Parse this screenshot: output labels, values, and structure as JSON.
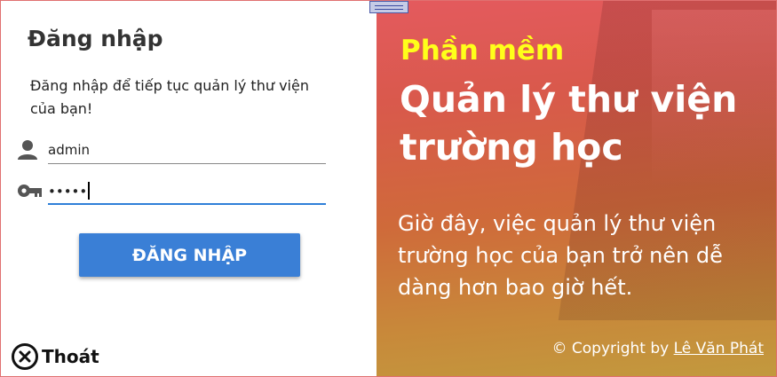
{
  "login": {
    "title": "Đăng nhập",
    "subtitle": "Đăng nhập để tiếp tục quản lý thư viện của bạn!",
    "username_value": "admin",
    "password_masked": "•••••",
    "login_button": "ĐĂNG NHẬP",
    "exit_label": "Thoát"
  },
  "icons": {
    "user": "person-icon",
    "key": "key-icon",
    "exit": "close-circle-icon"
  },
  "promo": {
    "kicker": "Phần mềm",
    "headline": "Quản lý thư viện trường học",
    "description": "Giờ đây, việc quản lý thư viện trường học của bạn trở nên dễ dàng hơn bao giờ hết.",
    "copyright_prefix": "© Copyright by ",
    "author": "Lê Văn Phát"
  },
  "colors": {
    "accent": "#3a7fd6",
    "kicker": "#ffff1a",
    "panel_gradient_top": "#e45a5e",
    "panel_gradient_bottom": "#c29a3e"
  }
}
